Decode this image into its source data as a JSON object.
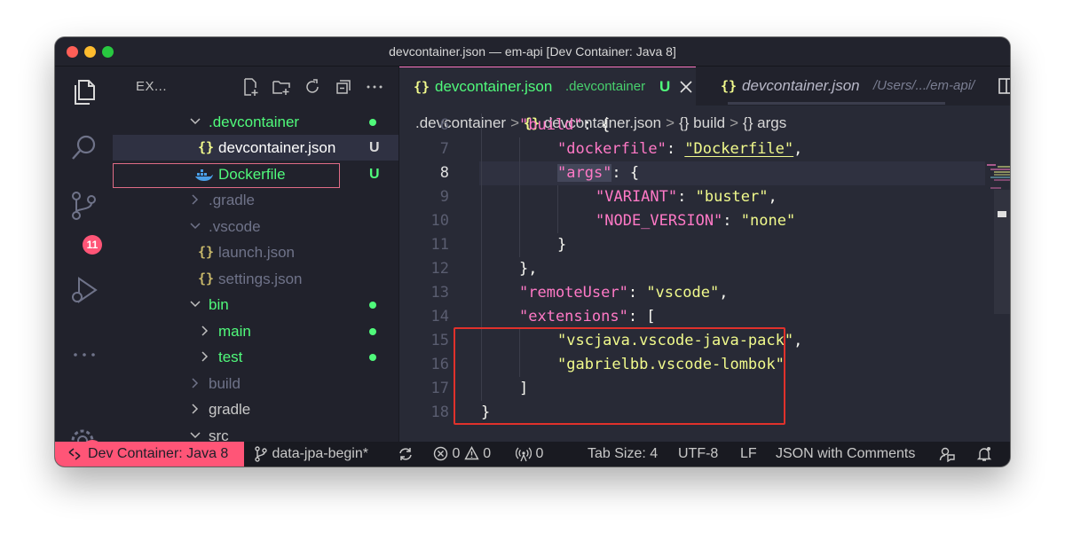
{
  "window": {
    "title": "devcontainer.json — em-api [Dev Container: Java 8]"
  },
  "activity_bar": {
    "source_control_badge": "11"
  },
  "explorer": {
    "header": "EX...",
    "items": [
      {
        "label": ".devcontainer",
        "kind": "folder-open",
        "git": "dot",
        "color": "#50fa7b"
      },
      {
        "label": "devcontainer.json",
        "kind": "json",
        "git": "U",
        "color": "#ffffff",
        "selected": true
      },
      {
        "label": "Dockerfile",
        "kind": "docker",
        "git": "U",
        "color": "#50fa7b"
      },
      {
        "label": ".gradle",
        "kind": "folder-closed",
        "color": "#6f7389"
      },
      {
        "label": ".vscode",
        "kind": "folder-open",
        "color": "#6f7389"
      },
      {
        "label": "launch.json",
        "kind": "json",
        "color": "#6f7389"
      },
      {
        "label": "settings.json",
        "kind": "json",
        "color": "#6f7389"
      },
      {
        "label": "bin",
        "kind": "folder-open",
        "git": "dot",
        "color": "#50fa7b"
      },
      {
        "label": "main",
        "kind": "folder-closed",
        "git": "dot",
        "color": "#50fa7b"
      },
      {
        "label": "test",
        "kind": "folder-closed",
        "git": "dot",
        "color": "#50fa7b"
      },
      {
        "label": "build",
        "kind": "folder-closed",
        "color": "#6f7389"
      },
      {
        "label": "gradle",
        "kind": "folder-closed",
        "color": "#c8c8c8"
      },
      {
        "label": "src",
        "kind": "folder-open",
        "color": "#c8c8c8"
      }
    ]
  },
  "tabs": {
    "active": {
      "icon": "{}",
      "name": "devcontainer.json",
      "dir": ".devcontainer",
      "status": "U"
    },
    "inactive": {
      "icon": "{}",
      "name": "devcontainer.json",
      "dir": "/Users/.../em-api/"
    }
  },
  "breadcrumb": {
    "folder": ".devcontainer",
    "file_icon": "{}",
    "file": "devcontainer.json",
    "sym1_icon": "{}",
    "sym1": "build",
    "sym2_icon": "{}",
    "sym2": "args"
  },
  "code": {
    "current_line": "8",
    "lines": [
      {
        "n": "6",
        "indent": 1,
        "parts": [
          [
            "k",
            "\"build\""
          ],
          [
            "p",
            ": {"
          ]
        ]
      },
      {
        "n": "7",
        "indent": 2,
        "parts": [
          [
            "k",
            "\"dockerfile\""
          ],
          [
            "p",
            ": "
          ],
          [
            "u",
            "\"Dockerfile\""
          ],
          [
            "p",
            ","
          ]
        ]
      },
      {
        "n": "8",
        "indent": 2,
        "parts": [
          [
            "kh",
            "\"args\""
          ],
          [
            "p",
            ": {"
          ]
        ]
      },
      {
        "n": "9",
        "indent": 3,
        "parts": [
          [
            "k",
            "\"VARIANT\""
          ],
          [
            "p",
            ": "
          ],
          [
            "s",
            "\"buster\""
          ],
          [
            "p",
            ","
          ]
        ]
      },
      {
        "n": "10",
        "indent": 3,
        "parts": [
          [
            "k",
            "\"NODE_VERSION\""
          ],
          [
            "p",
            ": "
          ],
          [
            "s",
            "\"none\""
          ]
        ]
      },
      {
        "n": "11",
        "indent": 2,
        "parts": [
          [
            "p",
            "}"
          ]
        ]
      },
      {
        "n": "12",
        "indent": 1,
        "parts": [
          [
            "p",
            "},"
          ]
        ]
      },
      {
        "n": "13",
        "indent": 1,
        "parts": [
          [
            "k",
            "\"remoteUser\""
          ],
          [
            "p",
            ": "
          ],
          [
            "s",
            "\"vscode\""
          ],
          [
            "p",
            ","
          ]
        ]
      },
      {
        "n": "14",
        "indent": 1,
        "parts": [
          [
            "k",
            "\"extensions\""
          ],
          [
            "p",
            ": ["
          ]
        ]
      },
      {
        "n": "15",
        "indent": 2,
        "parts": [
          [
            "s",
            "\"vscjava.vscode-java-pack\""
          ],
          [
            "p",
            ","
          ]
        ]
      },
      {
        "n": "16",
        "indent": 2,
        "parts": [
          [
            "s",
            "\"gabrielbb.vscode-lombok\""
          ]
        ]
      },
      {
        "n": "17",
        "indent": 1,
        "parts": [
          [
            "p",
            "]"
          ]
        ]
      },
      {
        "n": "18",
        "indent": 0,
        "parts": [
          [
            "p",
            "}"
          ]
        ]
      }
    ]
  },
  "statusbar": {
    "remote": "Dev Container: Java 8",
    "branch": "data-jpa-begin*",
    "errors": "0",
    "warnings": "0",
    "ports": "0",
    "tab_size": "Tab Size: 4",
    "encoding": "UTF-8",
    "eol": "LF",
    "language": "JSON with Comments"
  },
  "colors": {
    "accent_green": "#50fa7b",
    "accent_pink": "#ff79c6",
    "string_yellow": "#f1fa8c",
    "remote_bg": "#ff5577",
    "highlight_box": "#e0312b"
  }
}
